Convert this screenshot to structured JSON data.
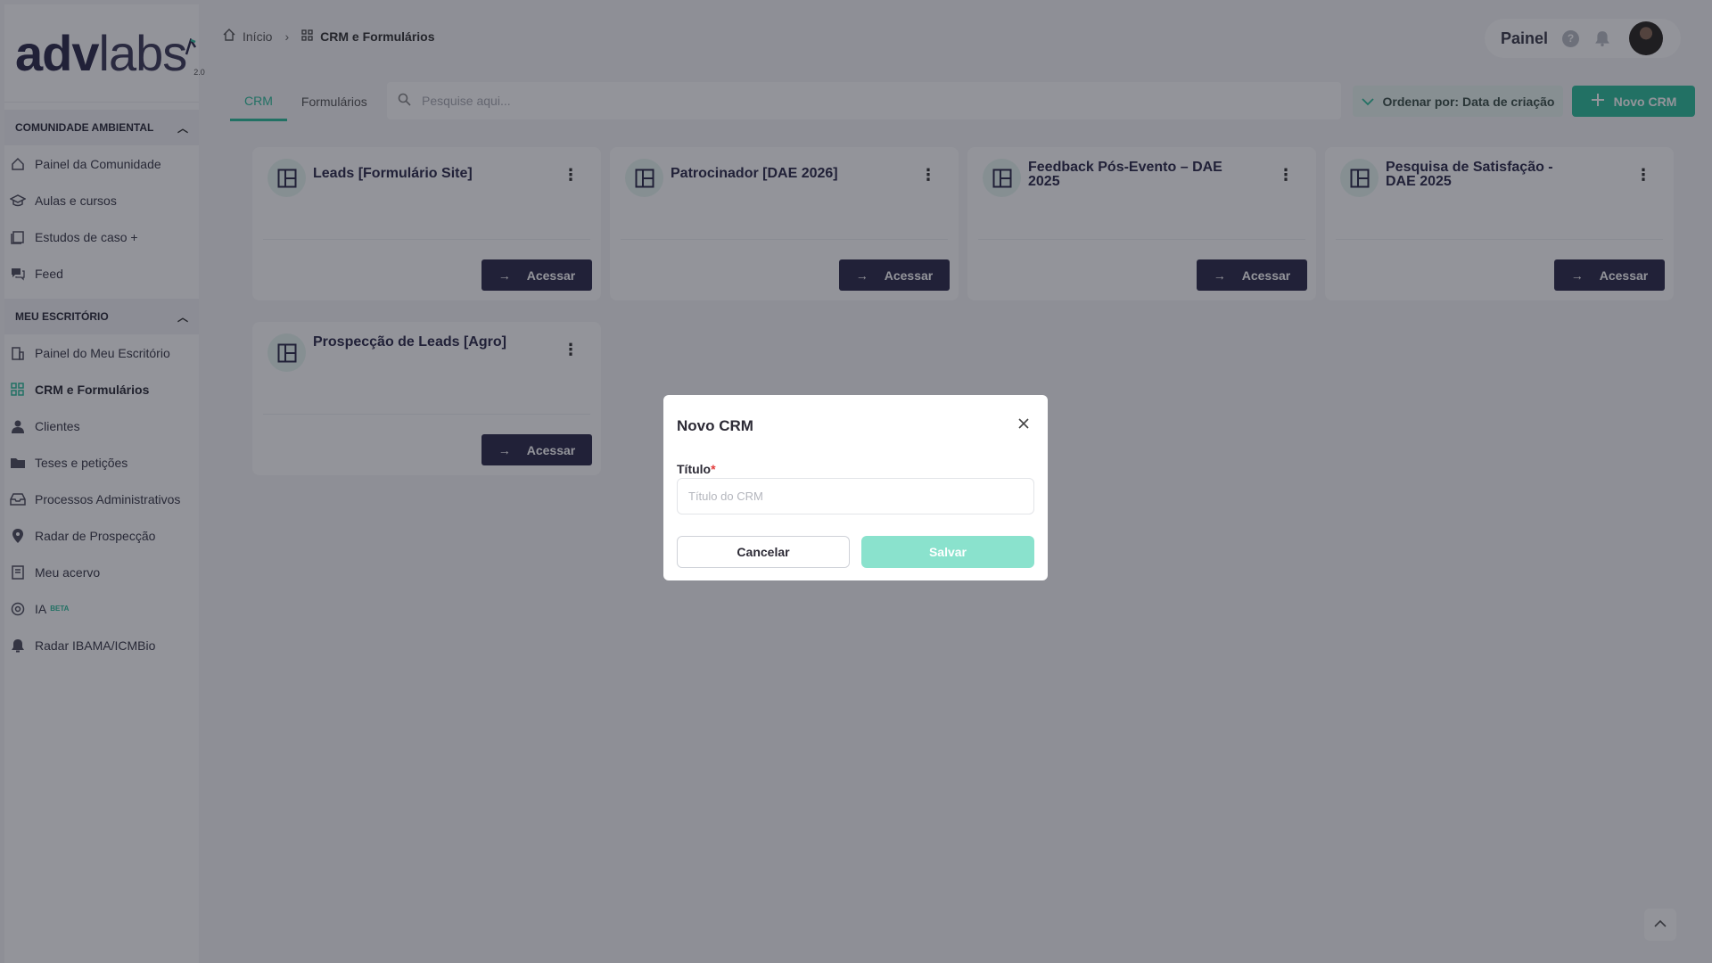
{
  "logo": {
    "main": "adv",
    "rest": "labs",
    "version": "2.0"
  },
  "sidebar": {
    "sections": [
      {
        "title": "COMUNIDADE AMBIENTAL",
        "items": [
          {
            "label": "Painel da Comunidade",
            "icon": "community-icon"
          },
          {
            "label": "Aulas e cursos",
            "icon": "graduation-cap-icon"
          },
          {
            "label": "Estudos de caso +",
            "icon": "book-icon"
          },
          {
            "label": "Feed",
            "icon": "chat-icon"
          }
        ]
      },
      {
        "title": "MEU ESCRITÓRIO",
        "items": [
          {
            "label": "Painel do Meu Escritório",
            "icon": "office-icon"
          },
          {
            "label": "CRM e Formulários",
            "icon": "grid-icon",
            "active": true
          },
          {
            "label": "Clientes",
            "icon": "user-icon"
          },
          {
            "label": "Teses e petições",
            "icon": "folder-icon"
          },
          {
            "label": "Processos Administrativos",
            "icon": "inbox-icon"
          },
          {
            "label": "Radar de Prospecção",
            "icon": "map-pin-icon"
          },
          {
            "label": "Meu acervo",
            "icon": "archive-icon"
          },
          {
            "label": "IA",
            "icon": "ai-icon",
            "badge": "BETA"
          },
          {
            "label": "Radar IBAMA/ICMBio",
            "icon": "bell-alert-icon"
          }
        ]
      }
    ]
  },
  "breadcrumb": {
    "home": "Início",
    "current": "CRM e Formulários"
  },
  "topbar": {
    "painel_label": "Painel",
    "help": "?"
  },
  "tabs": [
    {
      "label": "CRM",
      "active": true
    },
    {
      "label": "Formulários",
      "active": false
    }
  ],
  "search": {
    "placeholder": "Pesquise aqui..."
  },
  "sort": {
    "label": "Ordenar por: Data de criação"
  },
  "new_button": {
    "label": "Novo CRM"
  },
  "cards": [
    {
      "title": "Leads [Formulário Site]",
      "button": "Acessar"
    },
    {
      "title": "Patrocinador [DAE 2026]",
      "button": "Acessar"
    },
    {
      "title": "Feedback Pós-Evento – DAE 2025",
      "button": "Acessar"
    },
    {
      "title": "Pesquisa de Satisfação - DAE 2025",
      "button": "Acessar"
    },
    {
      "title": "Prospecção de Leads [Agro]",
      "button": "Acessar"
    }
  ],
  "modal": {
    "title": "Novo CRM",
    "field_label": "Título",
    "required_mark": "*",
    "field_placeholder": "Título do CRM",
    "field_value": "",
    "cancel_label": "Cancelar",
    "save_label": "Salvar"
  },
  "colors": {
    "accent": "#2fbf9b",
    "brand_dark": "#2d2b4a",
    "save_disabled": "#8ae2cd",
    "required": "#e23b3b"
  }
}
